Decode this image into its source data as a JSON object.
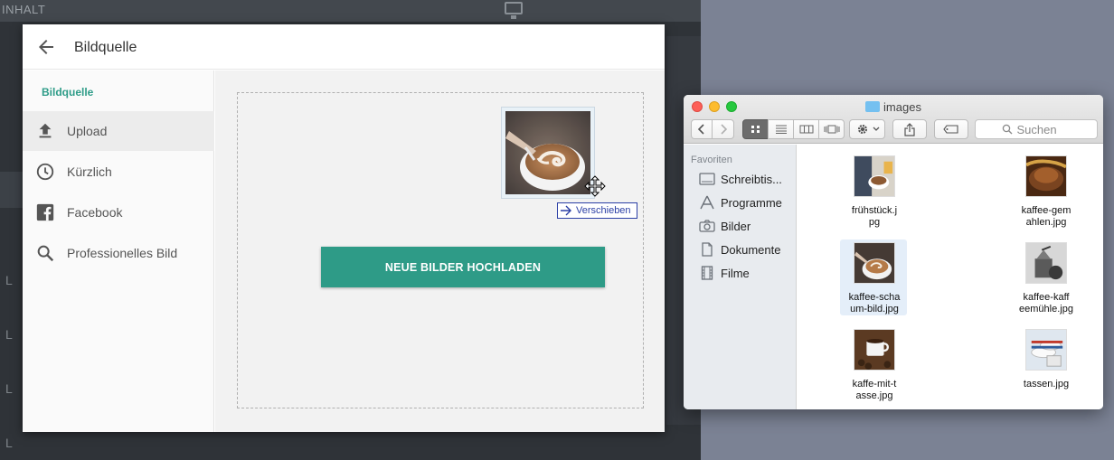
{
  "background": {
    "topbar_text": "INHALT",
    "side_letters": [
      "L",
      "L",
      "L",
      "L"
    ]
  },
  "dialog": {
    "title": "Bildquelle",
    "sidebar": {
      "heading": "Bildquelle",
      "items": [
        {
          "label": "Upload",
          "icon": "upload-icon",
          "active": true
        },
        {
          "label": "Kürzlich",
          "icon": "clock-icon",
          "active": false
        },
        {
          "label": "Facebook",
          "icon": "facebook-icon",
          "active": false
        },
        {
          "label": "Professionelles Bild",
          "icon": "search-icon",
          "active": false
        }
      ]
    },
    "upload_button": "NEUE BILDER HOCHLADEN",
    "drag_tooltip": "Verschieben"
  },
  "finder": {
    "title": "images",
    "search_placeholder": "Suchen",
    "favorites_label": "Favoriten",
    "sidebar_items": [
      {
        "label": "Schreibtis...",
        "icon": "desktop-icon"
      },
      {
        "label": "Programme",
        "icon": "applications-icon"
      },
      {
        "label": "Bilder",
        "icon": "camera-icon"
      },
      {
        "label": "Dokumente",
        "icon": "document-icon"
      },
      {
        "label": "Filme",
        "icon": "film-icon"
      }
    ],
    "files": [
      {
        "name": "frühstück.jpg",
        "line1": "frühstück.j",
        "line2": "pg",
        "selected": false
      },
      {
        "name": "kaffee-gemahlen.jpg",
        "line1": "kaffee-gem",
        "line2": "ahlen.jpg",
        "selected": false
      },
      {
        "name": "kaffee-schaum-bild.jpg",
        "line1": "kaffee-scha",
        "line2": "um-bild.jpg",
        "selected": true
      },
      {
        "name": "kaffee-kaffeemühle.jpg",
        "line1": "kaffee-kaff",
        "line2": "eemühle.jpg",
        "selected": false
      },
      {
        "name": "kaffe-mit-tasse.jpg",
        "line1": "kaffe-mit-t",
        "line2": "asse.jpg",
        "selected": false
      },
      {
        "name": "tassen.jpg",
        "line1": "tassen.jpg",
        "line2": "",
        "selected": false
      }
    ]
  },
  "colors": {
    "accent": "#2e9b87",
    "tooltip": "#2b3fa5",
    "selection": "#e4eef9"
  }
}
